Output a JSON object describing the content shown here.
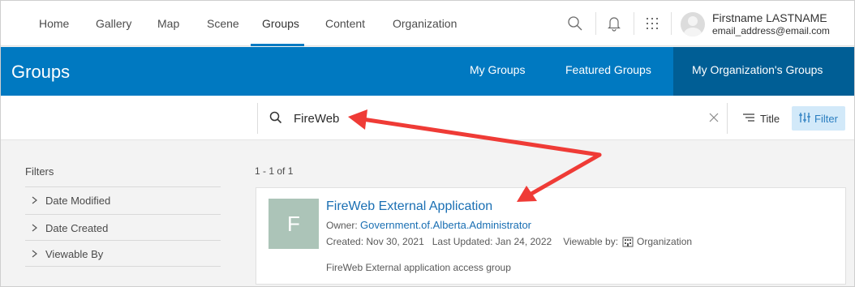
{
  "nav": {
    "items": [
      "Home",
      "Gallery",
      "Map",
      "Scene",
      "Groups",
      "Content",
      "Organization"
    ],
    "active": "Groups"
  },
  "user": {
    "name": "Firstname LASTNAME",
    "email": "email_address@email.com"
  },
  "icons": {
    "search": "search-icon",
    "notifications": "bell-icon",
    "apps": "app-launcher-icon",
    "clear": "close-icon",
    "sort": "sort-lines-icon",
    "filter": "filter-sliders-icon",
    "chevron": "chevron-right-icon",
    "viewable_by": "organization-icon"
  },
  "header": {
    "title": "Groups",
    "tabs": [
      "My Groups",
      "Featured Groups",
      "My Organization's Groups"
    ],
    "active_tab": "My Organization's Groups"
  },
  "search": {
    "value": "FireWeb",
    "sort_label": "Title",
    "filter_label": "Filter"
  },
  "filters": {
    "title": "Filters",
    "items": [
      "Date Modified",
      "Date Created",
      "Viewable By"
    ]
  },
  "results": {
    "count_label": "1 - 1 of 1",
    "cards": [
      {
        "thumb_letter": "F",
        "title": "FireWeb External Application",
        "owner_label": "Owner:",
        "owner": "Government.of.Alberta.Administrator",
        "created": "Created: Nov 30, 2021",
        "updated": "Last Updated: Jan 24, 2022",
        "viewable_label": "Viewable by:",
        "viewable_value": "Organization",
        "description": "FireWeb External application access group"
      }
    ]
  },
  "colors": {
    "brand_blue": "#0079c1",
    "active_tab": "#005e95",
    "link": "#1a6fb3",
    "annotation_arrow": "#ef3b36",
    "thumbnail": "#acc4b8"
  }
}
